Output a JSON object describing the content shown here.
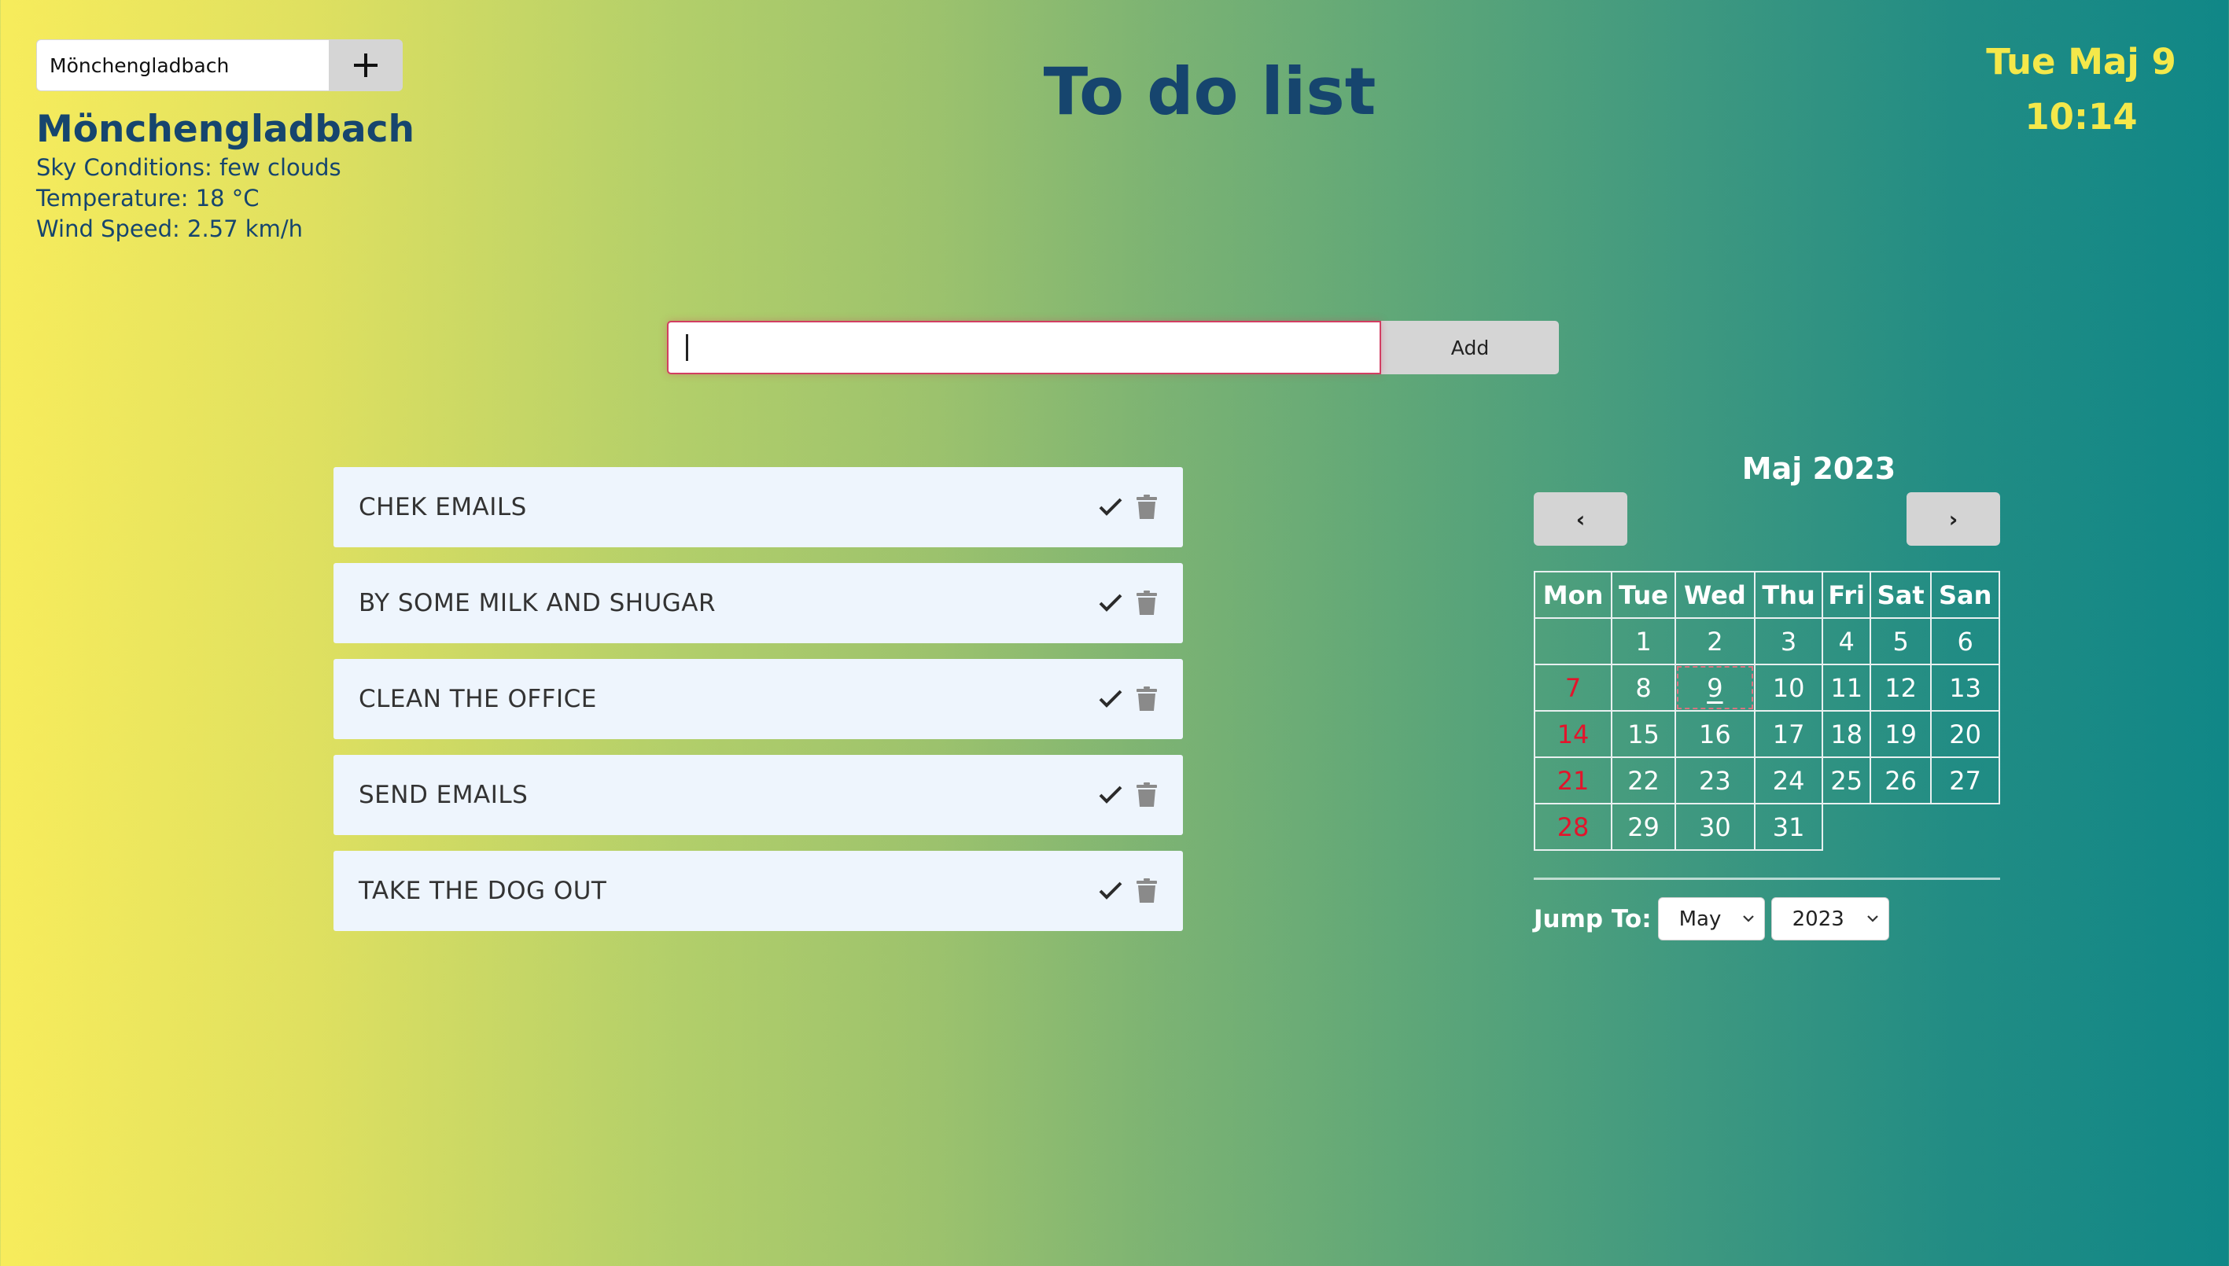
{
  "weather": {
    "search_value": "Mönchengladbach",
    "add_icon": "plus-icon",
    "city": "Mönchengladbach",
    "sky": "Sky Conditions: few clouds",
    "temperature": "Temperature: 18 °C",
    "wind": "Wind Speed: 2.57 km/h"
  },
  "header": {
    "title": "To do list"
  },
  "clock": {
    "date": "Tue Maj 9",
    "time": "10:14",
    "color": "#f4e84a"
  },
  "todo_form": {
    "input_value": "",
    "add_label": "Add",
    "input_border_color": "#d23e62"
  },
  "todos": [
    {
      "text": "CHEK EMAILS",
      "complete_icon": "check-icon",
      "delete_icon": "trash-icon"
    },
    {
      "text": "BY SOME MILK AND SHUGAR",
      "complete_icon": "check-icon",
      "delete_icon": "trash-icon"
    },
    {
      "text": "CLEAN THE OFFICE",
      "complete_icon": "check-icon",
      "delete_icon": "trash-icon"
    },
    {
      "text": "SEND EMAILS",
      "complete_icon": "check-icon",
      "delete_icon": "trash-icon"
    },
    {
      "text": "TAKE THE DOG OUT",
      "complete_icon": "check-icon",
      "delete_icon": "trash-icon"
    }
  ],
  "calendar": {
    "title": "Maj 2023",
    "prev_label": "‹",
    "next_label": "›",
    "weekdays": [
      "Mon",
      "Tue",
      "Wed",
      "Thu",
      "Fri",
      "Sat",
      "San"
    ],
    "weeks": [
      [
        "",
        "1",
        "2",
        "3",
        "4",
        "5",
        "6"
      ],
      [
        "7",
        "8",
        "9",
        "10",
        "11",
        "12",
        "13"
      ],
      [
        "14",
        "15",
        "16",
        "17",
        "18",
        "19",
        "20"
      ],
      [
        "21",
        "22",
        "23",
        "24",
        "25",
        "26",
        "27"
      ],
      [
        "28",
        "29",
        "30",
        "31",
        "",
        "",
        ""
      ]
    ],
    "today": "9",
    "sunday_color": "#e3142b",
    "jump_label": "Jump To:",
    "month_selected": "May",
    "year_selected": "2023"
  }
}
